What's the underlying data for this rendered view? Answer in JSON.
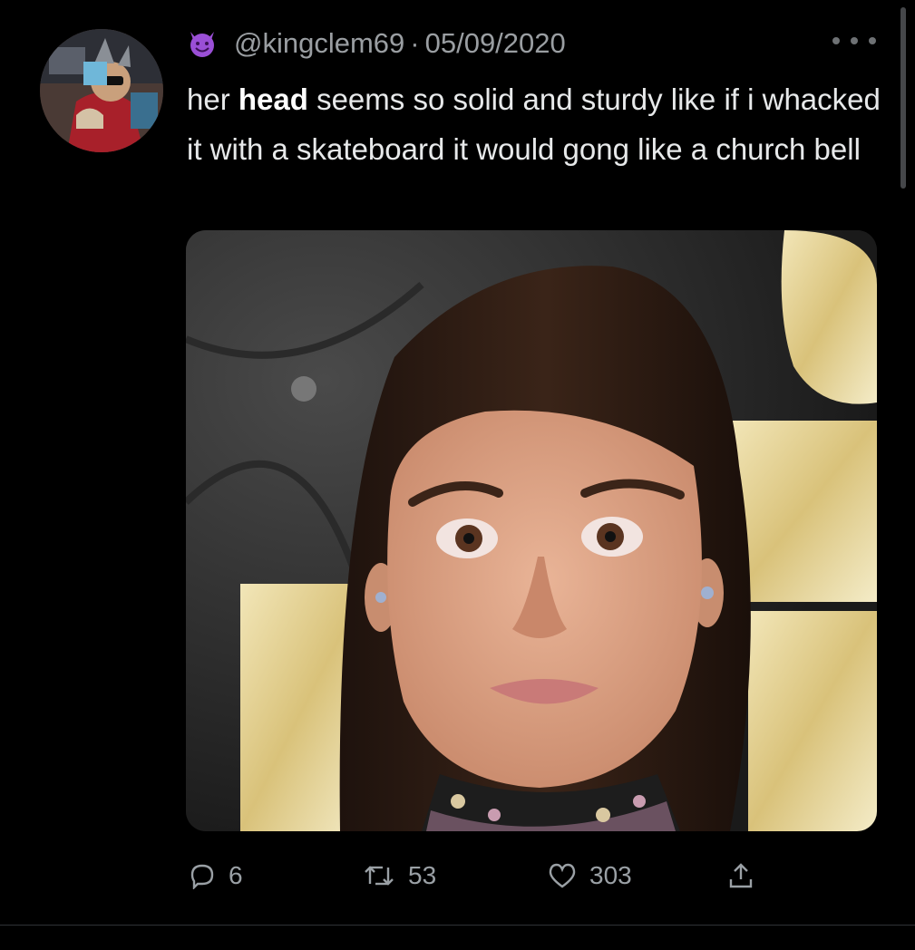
{
  "tweet": {
    "handle": "@kingclem69",
    "separator": "·",
    "date": "05/09/2020",
    "text_before": "her ",
    "text_bold": "head",
    "text_after": " seems so solid and sturdy like if i whacked it with a skateboard it would gong like a church bell",
    "emoji_icon": "smiling-imp-icon"
  },
  "actions": {
    "replies": "6",
    "retweets": "53",
    "likes": "303"
  },
  "colors": {
    "background": "#000000",
    "text": "#e7e9ea",
    "secondary": "#9aa0a5",
    "emoji": "#9a4fd6"
  }
}
